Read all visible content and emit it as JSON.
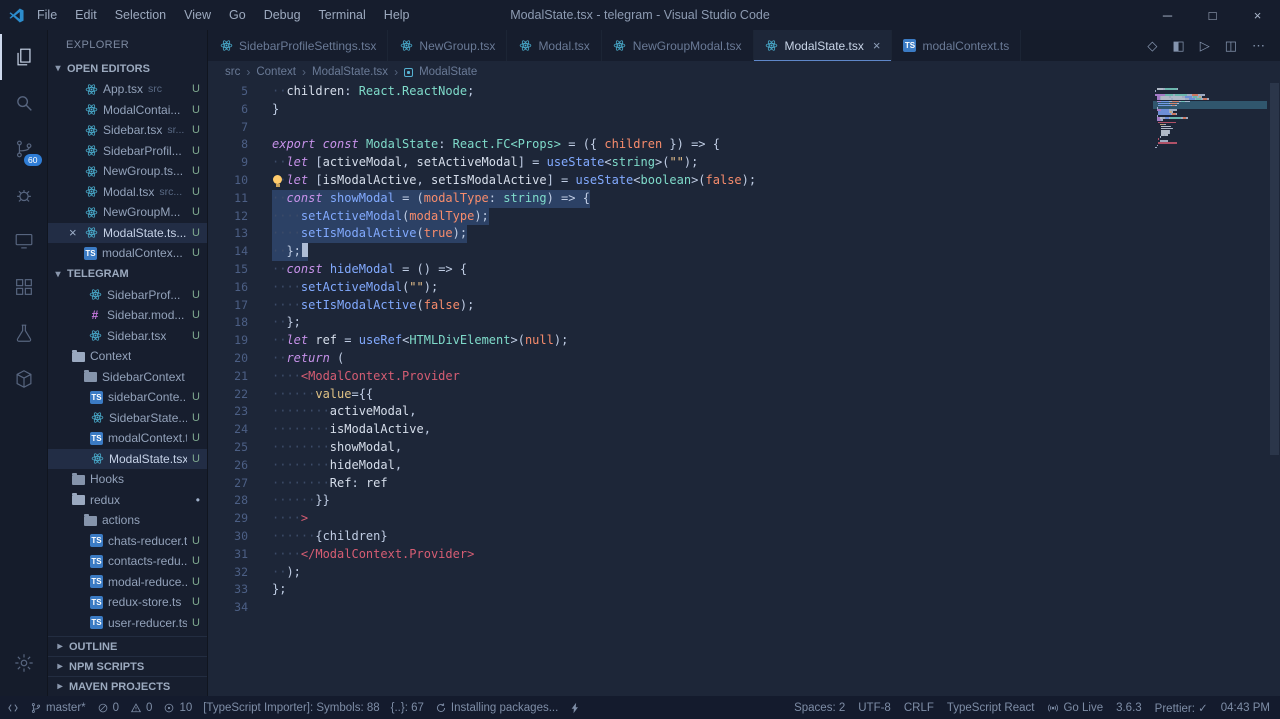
{
  "colors": {
    "accent_blue": "#2f7dd6",
    "untracked_green": "#7fa98f",
    "selection": "#2c4165"
  },
  "titlebar": {
    "title": "ModalState.tsx - telegram - Visual Studio Code",
    "menus": [
      "File",
      "Edit",
      "Selection",
      "View",
      "Go",
      "Debug",
      "Terminal",
      "Help"
    ],
    "window_controls": [
      {
        "name": "minimize"
      },
      {
        "name": "maximize"
      },
      {
        "name": "close"
      }
    ]
  },
  "activitybar": {
    "items": [
      {
        "name": "explorer",
        "active": true
      },
      {
        "name": "search"
      },
      {
        "name": "source-control",
        "badge": "60"
      },
      {
        "name": "debug"
      },
      {
        "name": "live-share"
      },
      {
        "name": "extensions"
      },
      {
        "name": "test"
      },
      {
        "name": "docker"
      }
    ]
  },
  "sidebar": {
    "header": "EXPLORER",
    "open_editors_label": "OPEN EDITORS",
    "project_label": "TELEGRAM",
    "open_editors": [
      {
        "label": "App.tsx",
        "detail": "src",
        "icon": "react",
        "badge": "U"
      },
      {
        "label": "ModalContai...",
        "detail": "",
        "icon": "react",
        "badge": "U"
      },
      {
        "label": "Sidebar.tsx",
        "detail": "sr...",
        "icon": "react",
        "badge": "U"
      },
      {
        "label": "SidebarProfil...",
        "detail": "",
        "icon": "react",
        "badge": "U"
      },
      {
        "label": "NewGroup.ts...",
        "detail": "",
        "icon": "react",
        "badge": "U"
      },
      {
        "label": "Modal.tsx",
        "detail": "src...",
        "icon": "react",
        "badge": "U"
      },
      {
        "label": "NewGroupM...",
        "detail": "",
        "icon": "react",
        "badge": "U"
      },
      {
        "label": "ModalState.ts...",
        "detail": "",
        "icon": "react",
        "badge": "U",
        "active": true
      },
      {
        "label": "modalContex...",
        "detail": "",
        "icon": "ts",
        "badge": "U"
      }
    ],
    "tree": [
      {
        "label": "SidebarProf...",
        "icon": "react",
        "badge": "U",
        "pad": 40
      },
      {
        "label": "Sidebar.mod...",
        "icon": "css",
        "badge": "U",
        "pad": 40
      },
      {
        "label": "Sidebar.tsx",
        "icon": "react",
        "badge": "U",
        "pad": 40
      },
      {
        "label": "Context",
        "icon": "folder-open",
        "pad": 24
      },
      {
        "label": "SidebarContext",
        "icon": "folder",
        "pad": 36
      },
      {
        "label": "sidebarConte...",
        "icon": "ts",
        "badge": "U",
        "pad": 42
      },
      {
        "label": "SidebarState...",
        "icon": "react",
        "badge": "U",
        "pad": 42
      },
      {
        "label": "modalContext.ts",
        "icon": "ts",
        "badge": "U",
        "pad": 42
      },
      {
        "label": "ModalState.tsx",
        "icon": "react",
        "badge": "U",
        "pad": 42,
        "selected": true
      },
      {
        "label": "Hooks",
        "icon": "folder",
        "pad": 24
      },
      {
        "label": "redux",
        "icon": "folder-open",
        "pad": 24,
        "dot": true
      },
      {
        "label": "actions",
        "icon": "folder",
        "pad": 36
      },
      {
        "label": "chats-reducer.ts",
        "icon": "ts",
        "badge": "U",
        "pad": 42
      },
      {
        "label": "contacts-redu...",
        "icon": "ts",
        "badge": "U",
        "pad": 42
      },
      {
        "label": "modal-reduce...",
        "icon": "ts",
        "badge": "U",
        "pad": 42
      },
      {
        "label": "redux-store.ts",
        "icon": "ts",
        "badge": "U",
        "pad": 42
      },
      {
        "label": "user-reducer.ts",
        "icon": "ts",
        "badge": "U",
        "pad": 42
      }
    ],
    "bottom_sections": [
      {
        "label": "OUTLINE"
      },
      {
        "label": "NPM SCRIPTS"
      },
      {
        "label": "MAVEN PROJECTS"
      }
    ]
  },
  "tabs": [
    {
      "label": "SidebarProfileSettings.tsx",
      "icon": "react"
    },
    {
      "label": "NewGroup.tsx",
      "icon": "react"
    },
    {
      "label": "Modal.tsx",
      "icon": "react"
    },
    {
      "label": "NewGroupModal.tsx",
      "icon": "react"
    },
    {
      "label": "ModalState.tsx",
      "icon": "react",
      "active": true,
      "close": true
    },
    {
      "label": "modalContext.ts",
      "icon": "ts"
    }
  ],
  "editor_actions": [
    {
      "name": "open-changes"
    },
    {
      "name": "toggle-layout"
    },
    {
      "name": "run"
    },
    {
      "name": "split-editor"
    },
    {
      "name": "more-actions"
    }
  ],
  "breadcrumb": {
    "path": [
      "src",
      "Context",
      "ModalState.tsx"
    ],
    "symbol": "ModalState"
  },
  "editor": {
    "lines": [
      {
        "n": 5,
        "tokens": [
          [
            "ws",
            "  "
          ],
          [
            "vr",
            "children"
          ],
          [
            "pn",
            ": "
          ],
          [
            "ty",
            "React.ReactNode"
          ],
          [
            "pn",
            ";"
          ]
        ]
      },
      {
        "n": 6,
        "tokens": [
          [
            "pn",
            "}"
          ]
        ]
      },
      {
        "n": 7,
        "tokens": []
      },
      {
        "n": 8,
        "tokens": [
          [
            "kw",
            "export "
          ],
          [
            "kw",
            "const "
          ],
          [
            "ty",
            "ModalState"
          ],
          [
            "pn",
            ": "
          ],
          [
            "ty",
            "React.FC<Props>"
          ],
          [
            "pn",
            " = ({ "
          ],
          [
            "nm",
            "children"
          ],
          [
            "pn",
            " }) => {"
          ]
        ]
      },
      {
        "n": 9,
        "tokens": [
          [
            "ws",
            "  "
          ],
          [
            "kw",
            "let "
          ],
          [
            "pn",
            "["
          ],
          [
            "vr",
            "activeModal"
          ],
          [
            "pn",
            ", "
          ],
          [
            "vr",
            "setActiveModal"
          ],
          [
            "pn",
            "] = "
          ],
          [
            "fn",
            "useState"
          ],
          [
            "pn",
            "<"
          ],
          [
            "ty",
            "string"
          ],
          [
            "pn",
            ">("
          ],
          [
            "st",
            "\"\""
          ],
          [
            "pn",
            ");"
          ]
        ]
      },
      {
        "n": 10,
        "bulb": true,
        "tokens": [
          [
            "ws",
            "  "
          ],
          [
            "kw",
            "let "
          ],
          [
            "pn",
            "["
          ],
          [
            "vr",
            "isModalActive"
          ],
          [
            "pn",
            ", "
          ],
          [
            "vr",
            "setIsModalActive"
          ],
          [
            "pn",
            "] = "
          ],
          [
            "fn",
            "useState"
          ],
          [
            "pn",
            "<"
          ],
          [
            "ty",
            "boolean"
          ],
          [
            "pn",
            ">("
          ],
          [
            "nm",
            "false"
          ],
          [
            "pn",
            ");"
          ]
        ]
      },
      {
        "n": 11,
        "sel": true,
        "tokens": [
          [
            "ws",
            "  "
          ],
          [
            "kw",
            "const "
          ],
          [
            "fn",
            "showModal"
          ],
          [
            "pn",
            " = ("
          ],
          [
            "nm",
            "modalType"
          ],
          [
            "pn",
            ": "
          ],
          [
            "ty",
            "string"
          ],
          [
            "pn",
            ") => {"
          ]
        ]
      },
      {
        "n": 12,
        "sel": true,
        "tokens": [
          [
            "ws",
            "    "
          ],
          [
            "fn",
            "setActiveModal"
          ],
          [
            "pn",
            "("
          ],
          [
            "nm",
            "modalType"
          ],
          [
            "pn",
            ");"
          ]
        ]
      },
      {
        "n": 13,
        "sel": true,
        "tokens": [
          [
            "ws",
            "    "
          ],
          [
            "fn",
            "setIsModalActive"
          ],
          [
            "pn",
            "("
          ],
          [
            "nm",
            "true"
          ],
          [
            "pn",
            ");"
          ]
        ]
      },
      {
        "n": 14,
        "sel": true,
        "cursor": true,
        "tokens": [
          [
            "ws",
            "  "
          ],
          [
            "pn",
            "};"
          ]
        ]
      },
      {
        "n": 15,
        "tokens": [
          [
            "ws",
            "  "
          ],
          [
            "kw",
            "const "
          ],
          [
            "fn",
            "hideModal"
          ],
          [
            "pn",
            " = () => {"
          ]
        ]
      },
      {
        "n": 16,
        "tokens": [
          [
            "ws",
            "    "
          ],
          [
            "fn",
            "setActiveModal"
          ],
          [
            "pn",
            "("
          ],
          [
            "st",
            "\"\""
          ],
          [
            "pn",
            ");"
          ]
        ]
      },
      {
        "n": 17,
        "tokens": [
          [
            "ws",
            "    "
          ],
          [
            "fn",
            "setIsModalActive"
          ],
          [
            "pn",
            "("
          ],
          [
            "nm",
            "false"
          ],
          [
            "pn",
            ");"
          ]
        ]
      },
      {
        "n": 18,
        "tokens": [
          [
            "ws",
            "  "
          ],
          [
            "pn",
            "};"
          ]
        ]
      },
      {
        "n": 19,
        "tokens": [
          [
            "ws",
            "  "
          ],
          [
            "kw",
            "let "
          ],
          [
            "vr",
            "ref"
          ],
          [
            "pn",
            " = "
          ],
          [
            "fn",
            "useRef"
          ],
          [
            "pn",
            "<"
          ],
          [
            "ty",
            "HTMLDivElement"
          ],
          [
            "pn",
            ">("
          ],
          [
            "nm",
            "null"
          ],
          [
            "pn",
            ");"
          ]
        ]
      },
      {
        "n": 20,
        "tokens": [
          [
            "ws",
            "  "
          ],
          [
            "kw",
            "return"
          ],
          [
            "pn",
            " ("
          ]
        ]
      },
      {
        "n": 21,
        "tokens": [
          [
            "ws",
            "    "
          ],
          [
            "tg",
            "<ModalContext.Provider"
          ]
        ]
      },
      {
        "n": 22,
        "tokens": [
          [
            "ws",
            "      "
          ],
          [
            "at",
            "value"
          ],
          [
            "pn",
            "={{"
          ]
        ]
      },
      {
        "n": 23,
        "tokens": [
          [
            "ws",
            "        "
          ],
          [
            "vr",
            "activeModal"
          ],
          [
            "pn",
            ","
          ]
        ]
      },
      {
        "n": 24,
        "tokens": [
          [
            "ws",
            "        "
          ],
          [
            "vr",
            "isModalActive"
          ],
          [
            "pn",
            ","
          ]
        ]
      },
      {
        "n": 25,
        "tokens": [
          [
            "ws",
            "        "
          ],
          [
            "vr",
            "showModal"
          ],
          [
            "pn",
            ","
          ]
        ]
      },
      {
        "n": 26,
        "tokens": [
          [
            "ws",
            "        "
          ],
          [
            "vr",
            "hideModal"
          ],
          [
            "pn",
            ","
          ]
        ]
      },
      {
        "n": 27,
        "tokens": [
          [
            "ws",
            "        "
          ],
          [
            "vr",
            "Ref"
          ],
          [
            "pn",
            ": "
          ],
          [
            "vr",
            "ref"
          ]
        ]
      },
      {
        "n": 28,
        "tokens": [
          [
            "ws",
            "      "
          ],
          [
            "pn",
            "}}"
          ]
        ]
      },
      {
        "n": 29,
        "tokens": [
          [
            "ws",
            "    "
          ],
          [
            "tg",
            ">"
          ]
        ]
      },
      {
        "n": 30,
        "tokens": [
          [
            "ws",
            "      "
          ],
          [
            "pn",
            "{children}"
          ]
        ]
      },
      {
        "n": 31,
        "tokens": [
          [
            "ws",
            "    "
          ],
          [
            "tg",
            "</ModalContext.Provider>"
          ]
        ]
      },
      {
        "n": 32,
        "tokens": [
          [
            "ws",
            "  "
          ],
          [
            "pn",
            ");"
          ]
        ]
      },
      {
        "n": 33,
        "tokens": [
          [
            "pn",
            "};"
          ]
        ]
      },
      {
        "n": 34,
        "tokens": []
      }
    ]
  },
  "statusbar": {
    "left": [
      {
        "name": "remote",
        "icon": "remote",
        "text": ""
      },
      {
        "name": "git-branch",
        "icon": "branch",
        "text": "master*"
      },
      {
        "name": "errors",
        "icon": "error",
        "text": "0"
      },
      {
        "name": "warnings",
        "icon": "warning",
        "text": "0"
      },
      {
        "name": "info-count",
        "icon": "circle-dot",
        "text": "10"
      },
      {
        "name": "ts-importer",
        "text": "[TypeScript Importer]: Symbols: 88"
      },
      {
        "name": "import-cost",
        "text": "{..}: 67"
      },
      {
        "name": "installing",
        "icon": "sync",
        "text": "Installing packages..."
      },
      {
        "name": "plug",
        "icon": "zap",
        "text": ""
      }
    ],
    "right": [
      {
        "name": "indentation",
        "text": "Spaces: 2"
      },
      {
        "name": "encoding",
        "text": "UTF-8"
      },
      {
        "name": "eol",
        "text": "CRLF"
      },
      {
        "name": "language-mode",
        "text": "TypeScript React"
      },
      {
        "name": "go-live",
        "icon": "broadcast",
        "text": "Go Live"
      },
      {
        "name": "version",
        "text": "3.6.3"
      },
      {
        "name": "prettier",
        "text": "Prettier: ✓"
      },
      {
        "name": "clock",
        "text": "04:43 PM"
      }
    ]
  }
}
